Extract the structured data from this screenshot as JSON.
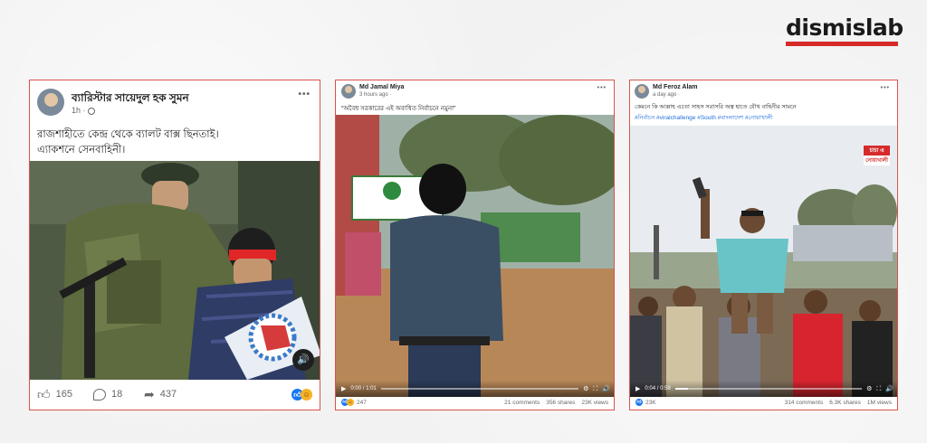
{
  "brand": {
    "logo_text": "dismislab",
    "accent": "#d62a2a"
  },
  "posts": [
    {
      "author": "ব্যারিস্টার সায়েদুল হক সুমন",
      "time": "1h ·",
      "globe_icon": "globe-icon",
      "caption_line1": "রাজশাহীতে কেন্দ্র থেকে ব্যালট বাক্স ছিনতাই।",
      "caption_line2": "এ্যাকশনে সেনবাহিনী।",
      "more": "•••",
      "likes": "165",
      "comments": "18",
      "shares": "437"
    },
    {
      "author": "Md Jamal Miya",
      "time": "3 hours ago ·",
      "caption": "“অবৈধ সরকারের এই অবাধিত নির্বাচনে নমুনা”",
      "more": "•••",
      "video_time": "0:00 / 1:01",
      "progress": 0.0,
      "reactions": "247",
      "comments": "21 comments",
      "shares": "356 shares",
      "views": "23K views"
    },
    {
      "author": "Md Feroz Alam",
      "time": "a day ago ·",
      "caption": "কেমনে কি আল্লাহ এতো সাহস সরাসরি অস্ত্র হাতে যৌথ বাহিনীর সামনে",
      "hashtags": "#নির্বাচন #viralchallenge #South #বাংলাদেশ #নোয়াখালী",
      "watermark_line1": "চাচা এ",
      "watermark_line2": "নোয়াখালী",
      "more": "•••",
      "video_time": "0:04 / 0:59",
      "progress": 0.07,
      "reactions": "23K",
      "comments": "314 comments",
      "shares": "6.3K shares",
      "views": "1M views"
    }
  ]
}
